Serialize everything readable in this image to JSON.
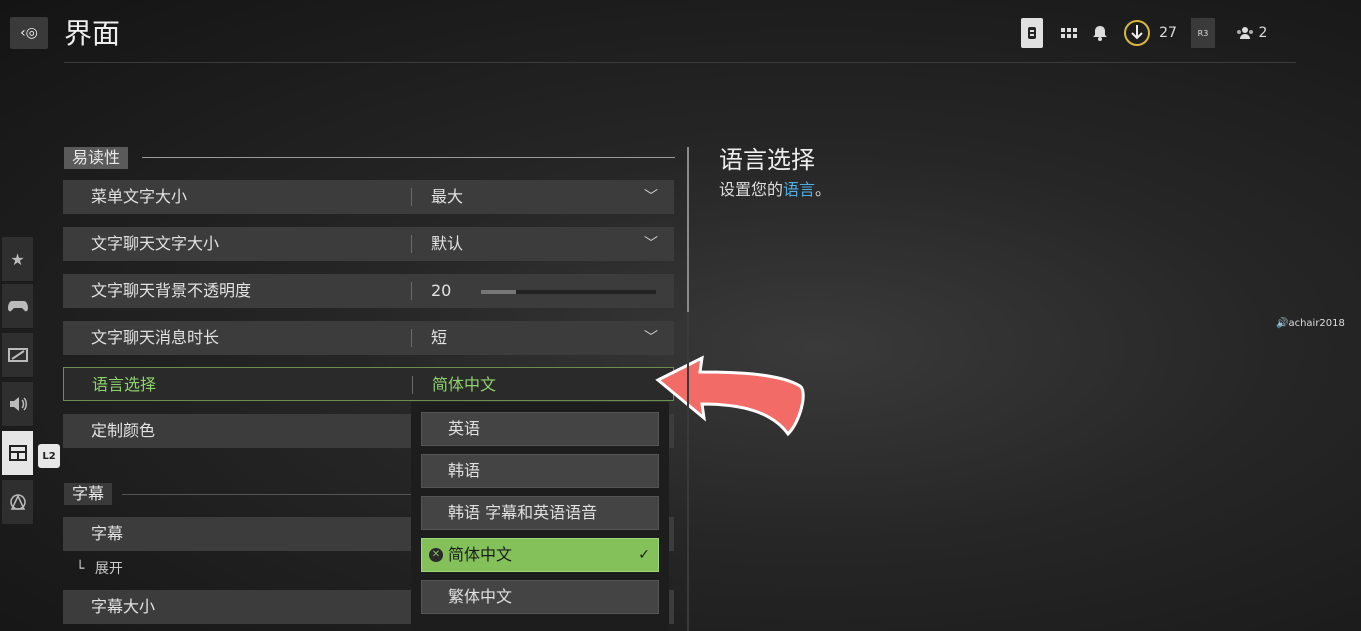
{
  "header": {
    "back_icon": "back-icon",
    "title": "界面",
    "icons": [
      {
        "name": "storage-icon",
        "glyph": "▮"
      },
      {
        "name": "grid-icon",
        "glyph": "▦"
      },
      {
        "name": "bell-icon",
        "glyph": "🔔"
      },
      {
        "name": "download-icon",
        "glyph": "↓",
        "count": "27"
      },
      {
        "name": "r3-controller-icon",
        "glyph": "R3"
      },
      {
        "name": "party-icon",
        "glyph": "👥",
        "count": "2"
      }
    ]
  },
  "rail": [
    {
      "name": "favorites-icon",
      "glyph": "★"
    },
    {
      "name": "controller-icon",
      "glyph": "🎮"
    },
    {
      "name": "display-icon",
      "glyph": "▨"
    },
    {
      "name": "audio-icon",
      "glyph": "🔊"
    },
    {
      "name": "interface-icon",
      "glyph": "▤"
    },
    {
      "name": "network-icon",
      "glyph": "◬"
    }
  ],
  "l2_badge": "L2",
  "sections": {
    "readability": "易读性",
    "subtitles": "字幕"
  },
  "rows": [
    {
      "label": "菜单文字大小",
      "value": "最大"
    },
    {
      "label": "文字聊天文字大小",
      "value": "默认"
    },
    {
      "label": "文字聊天背景不透明度",
      "value": "20",
      "slider_fraction": 0.2
    },
    {
      "label": "文字聊天消息时长",
      "value": "短"
    },
    {
      "label": "语言选择",
      "value": "简体中文"
    },
    {
      "label": "定制颜色",
      "value": ""
    }
  ],
  "subtitle_rows": [
    {
      "label": "字幕"
    },
    {
      "label": "展开",
      "prefix": "└"
    },
    {
      "label": "字幕大小"
    }
  ],
  "dropdown": {
    "options": [
      "英语",
      "韩语",
      "韩语 字幕和英语语音",
      "简体中文",
      "繁体中文"
    ],
    "selected": "简体中文",
    "check": "✓"
  },
  "detail": {
    "title": "语言选择",
    "desc_prefix": "设置您的",
    "desc_highlight": "语言",
    "desc_suffix": "。"
  },
  "watermark": "🔊achair2018",
  "colors": {
    "accent_green": "#84c15a",
    "selected_text": "#8cd36b",
    "link_blue": "#4fb0e6"
  }
}
